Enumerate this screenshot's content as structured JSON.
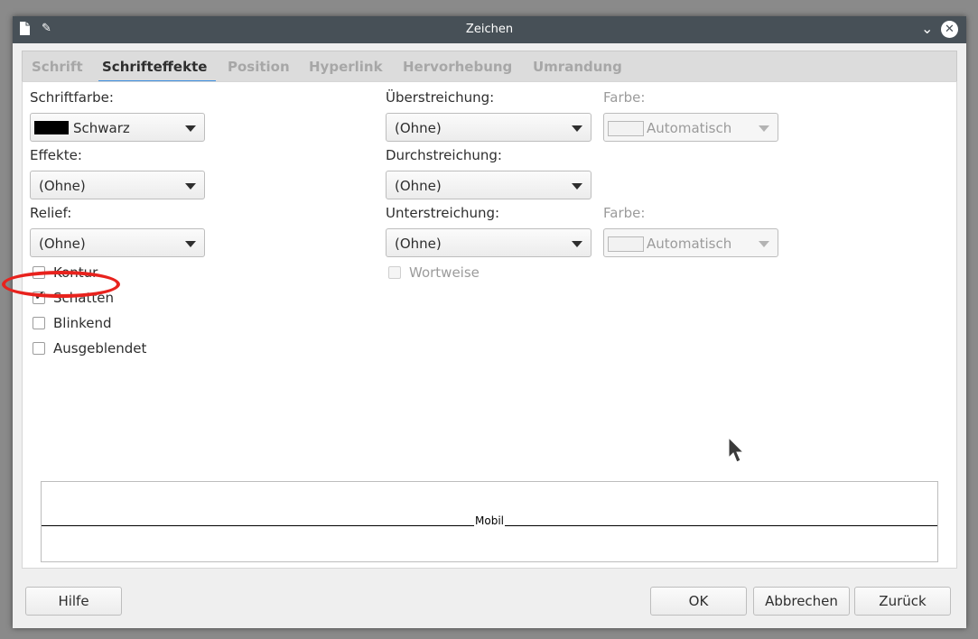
{
  "window": {
    "title": "Zeichen"
  },
  "tabs": [
    {
      "label": "Schrift",
      "active": false
    },
    {
      "label": "Schrifteffekte",
      "active": true
    },
    {
      "label": "Position",
      "active": false
    },
    {
      "label": "Hyperlink",
      "active": false
    },
    {
      "label": "Hervorhebung",
      "active": false
    },
    {
      "label": "Umrandung",
      "active": false
    }
  ],
  "left": {
    "font_color": {
      "label": "Schriftfarbe:",
      "value": "Schwarz",
      "swatch": "#000000"
    },
    "effects": {
      "label": "Effekte:",
      "value": "(Ohne)"
    },
    "relief": {
      "label": "Relief:",
      "value": "(Ohne)"
    },
    "checkboxes": [
      {
        "label": "Kontur",
        "checked": false
      },
      {
        "label": "Schatten",
        "checked": true
      },
      {
        "label": "Blinkend",
        "checked": false
      },
      {
        "label": "Ausgeblendet",
        "checked": false
      }
    ]
  },
  "right": {
    "overline": {
      "label": "Überstreichung:",
      "value": "(Ohne)"
    },
    "overline_color": {
      "label": "Farbe:",
      "value": "Automatisch"
    },
    "strikethrough": {
      "label": "Durchstreichung:",
      "value": "(Ohne)"
    },
    "underline": {
      "label": "Unterstreichung:",
      "value": "(Ohne)"
    },
    "underline_color": {
      "label": "Farbe:",
      "value": "Automatisch"
    },
    "word_by_word": {
      "label": "Wortweise",
      "checked": false
    }
  },
  "preview": {
    "sample_text": "Mobil"
  },
  "buttons": {
    "help": "Hilfe",
    "ok": "OK",
    "cancel": "Abbrechen",
    "reset": "Zurück"
  },
  "colors": {
    "highlight": "#e8221d",
    "tab_accent": "#3d8fe0"
  }
}
